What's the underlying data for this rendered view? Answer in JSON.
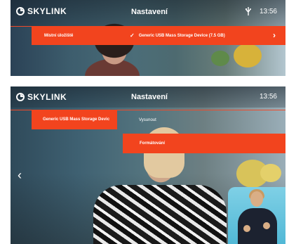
{
  "brand": {
    "name": "SKYLINK"
  },
  "colors": {
    "accent": "#f2441e",
    "text": "#ffffff"
  },
  "screen_top": {
    "title": "Nastavení",
    "clock": "13:56",
    "menu": {
      "local_storage": "Místní úložiště",
      "usb_device": "Generic USB Mass Storage Device (7.5 GB)",
      "check_icon": "check-icon",
      "arrow_icon": "chevron-right-icon"
    }
  },
  "screen_bottom": {
    "title": "Nastavení",
    "clock": "13:56",
    "menu": {
      "usb_device": "Generic USB Mass Storage Devic",
      "eject": "Vysunout",
      "format": "Formátování",
      "back_icon": "chevron-left-icon"
    }
  }
}
